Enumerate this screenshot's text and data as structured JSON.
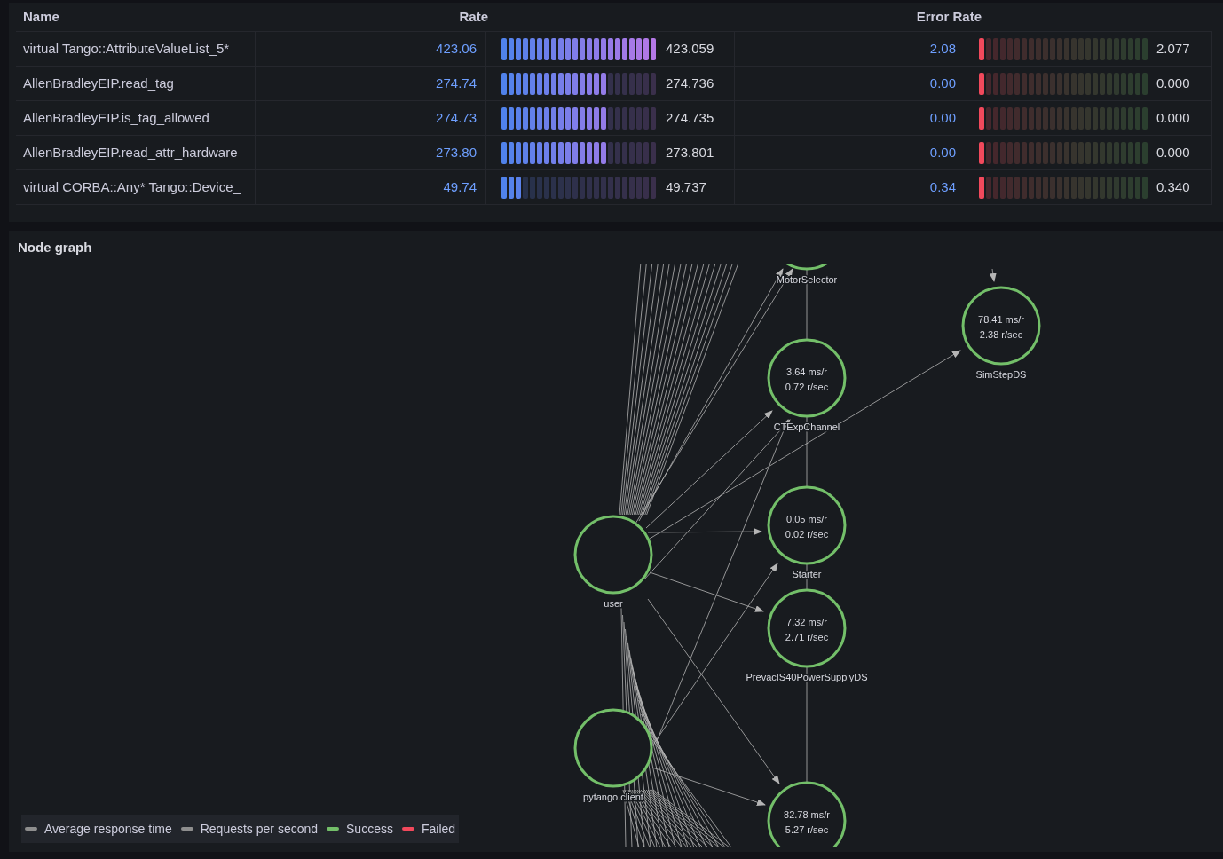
{
  "table": {
    "columns": [
      {
        "label": "Name"
      },
      {
        "label": "Rate"
      },
      {
        "label": "Error Rate"
      }
    ],
    "rows": [
      {
        "name": "virtual Tango::AttributeValueList_5*",
        "rate": "423.06",
        "rate_reading": "423.059",
        "error_rate": "2.08",
        "error_reading": "2.077"
      },
      {
        "name": "AllenBradleyEIP.read_tag",
        "rate": "274.74",
        "rate_reading": "274.736",
        "error_rate": "0.00",
        "error_reading": "0.000"
      },
      {
        "name": "AllenBradleyEIP.is_tag_allowed",
        "rate": "274.73",
        "rate_reading": "274.735",
        "error_rate": "0.00",
        "error_reading": "0.000"
      },
      {
        "name": "AllenBradleyEIP.read_attr_hardware",
        "rate": "273.80",
        "rate_reading": "273.801",
        "error_rate": "0.00",
        "error_reading": "0.000"
      },
      {
        "name": "virtual CORBA::Any* Tango::Device_",
        "rate": "49.74",
        "rate_reading": "49.737",
        "error_rate": "0.34",
        "error_reading": "0.340"
      }
    ]
  },
  "node_graph": {
    "title": "Node graph",
    "nodes": [
      {
        "label": "MotorSelector"
      },
      {
        "label": "SimStepDS",
        "stats": [
          "78.41 ms/r",
          "2.38 r/sec"
        ]
      },
      {
        "label": "CTExpChannel",
        "stats": [
          "3.64 ms/r",
          "0.72 r/sec"
        ]
      },
      {
        "label": "Starter",
        "stats": [
          "0.05 ms/r",
          "0.02 r/sec"
        ]
      },
      {
        "label": "user"
      },
      {
        "label": "PrevacIS40PowerSupplyDS",
        "stats": [
          "7.32 ms/r",
          "2.71 r/sec"
        ]
      },
      {
        "label": "pytango.client"
      },
      {
        "stats": [
          "82.78 ms/r",
          "5.27 r/sec"
        ]
      }
    ],
    "legend": [
      {
        "label": "Average response time",
        "color": "#8e8e8e"
      },
      {
        "label": "Requests per second",
        "color": "#8e8e8e"
      },
      {
        "label": "Success",
        "color": "#73bf69"
      },
      {
        "label": "Failed",
        "color": "#f2495c"
      }
    ]
  }
}
